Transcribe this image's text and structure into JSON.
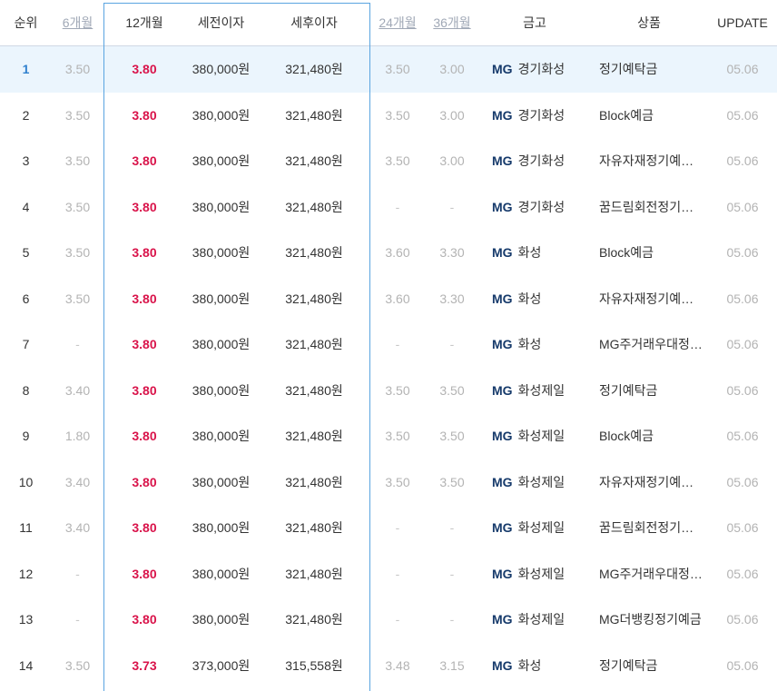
{
  "headers": {
    "rank": "순위",
    "m6": "6개월",
    "m12": "12개월",
    "pretax": "세전이자",
    "posttax": "세후이자",
    "m24": "24개월",
    "m36": "36개월",
    "bank": "금고",
    "product": "상품",
    "update": "UPDATE"
  },
  "rows": [
    {
      "rank": "1",
      "m6": "3.50",
      "m12": "3.80",
      "pretax": "380,000원",
      "posttax": "321,480원",
      "m24": "3.50",
      "m36": "3.00",
      "bank_logo": "MG",
      "bank": "경기화성",
      "product": "정기예탁금",
      "update": "05.06"
    },
    {
      "rank": "2",
      "m6": "3.50",
      "m12": "3.80",
      "pretax": "380,000원",
      "posttax": "321,480원",
      "m24": "3.50",
      "m36": "3.00",
      "bank_logo": "MG",
      "bank": "경기화성",
      "product": "Block예금",
      "update": "05.06"
    },
    {
      "rank": "3",
      "m6": "3.50",
      "m12": "3.80",
      "pretax": "380,000원",
      "posttax": "321,480원",
      "m24": "3.50",
      "m36": "3.00",
      "bank_logo": "MG",
      "bank": "경기화성",
      "product": "자유자재정기예…",
      "update": "05.06"
    },
    {
      "rank": "4",
      "m6": "3.50",
      "m12": "3.80",
      "pretax": "380,000원",
      "posttax": "321,480원",
      "m24": "-",
      "m36": "-",
      "bank_logo": "MG",
      "bank": "경기화성",
      "product": "꿈드림회전정기…",
      "update": "05.06"
    },
    {
      "rank": "5",
      "m6": "3.50",
      "m12": "3.80",
      "pretax": "380,000원",
      "posttax": "321,480원",
      "m24": "3.60",
      "m36": "3.30",
      "bank_logo": "MG",
      "bank": "화성",
      "product": "Block예금",
      "update": "05.06"
    },
    {
      "rank": "6",
      "m6": "3.50",
      "m12": "3.80",
      "pretax": "380,000원",
      "posttax": "321,480원",
      "m24": "3.60",
      "m36": "3.30",
      "bank_logo": "MG",
      "bank": "화성",
      "product": "자유자재정기예…",
      "update": "05.06"
    },
    {
      "rank": "7",
      "m6": "-",
      "m12": "3.80",
      "pretax": "380,000원",
      "posttax": "321,480원",
      "m24": "-",
      "m36": "-",
      "bank_logo": "MG",
      "bank": "화성",
      "product": "MG주거래우대정…",
      "update": "05.06"
    },
    {
      "rank": "8",
      "m6": "3.40",
      "m12": "3.80",
      "pretax": "380,000원",
      "posttax": "321,480원",
      "m24": "3.50",
      "m36": "3.50",
      "bank_logo": "MG",
      "bank": "화성제일",
      "product": "정기예탁금",
      "update": "05.06"
    },
    {
      "rank": "9",
      "m6": "1.80",
      "m12": "3.80",
      "pretax": "380,000원",
      "posttax": "321,480원",
      "m24": "3.50",
      "m36": "3.50",
      "bank_logo": "MG",
      "bank": "화성제일",
      "product": "Block예금",
      "update": "05.06"
    },
    {
      "rank": "10",
      "m6": "3.40",
      "m12": "3.80",
      "pretax": "380,000원",
      "posttax": "321,480원",
      "m24": "3.50",
      "m36": "3.50",
      "bank_logo": "MG",
      "bank": "화성제일",
      "product": "자유자재정기예…",
      "update": "05.06"
    },
    {
      "rank": "11",
      "m6": "3.40",
      "m12": "3.80",
      "pretax": "380,000원",
      "posttax": "321,480원",
      "m24": "-",
      "m36": "-",
      "bank_logo": "MG",
      "bank": "화성제일",
      "product": "꿈드림회전정기…",
      "update": "05.06"
    },
    {
      "rank": "12",
      "m6": "-",
      "m12": "3.80",
      "pretax": "380,000원",
      "posttax": "321,480원",
      "m24": "-",
      "m36": "-",
      "bank_logo": "MG",
      "bank": "화성제일",
      "product": "MG주거래우대정…",
      "update": "05.06"
    },
    {
      "rank": "13",
      "m6": "-",
      "m12": "3.80",
      "pretax": "380,000원",
      "posttax": "321,480원",
      "m24": "-",
      "m36": "-",
      "bank_logo": "MG",
      "bank": "화성제일",
      "product": "MG더뱅킹정기예금",
      "update": "05.06"
    },
    {
      "rank": "14",
      "m6": "3.50",
      "m12": "3.73",
      "pretax": "373,000원",
      "posttax": "315,558원",
      "m24": "3.48",
      "m36": "3.15",
      "bank_logo": "MG",
      "bank": "화성",
      "product": "정기예탁금",
      "update": "05.06"
    }
  ],
  "colors": {
    "rate_red": "#d9134a",
    "rank_highlight_blue": "#2f80ce",
    "row_highlight_bg": "#ebf5fd",
    "focus_border": "#5aa4e0",
    "mg_navy": "#163a6b"
  }
}
